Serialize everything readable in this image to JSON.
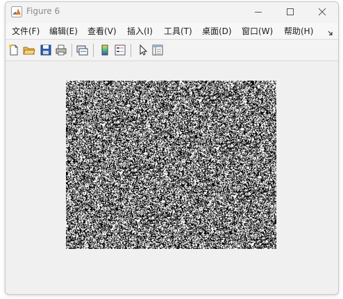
{
  "window": {
    "title": "Figure 6",
    "icons": {
      "app": "matlab-logo-icon",
      "minimize": "minimize-icon",
      "maximize": "maximize-icon",
      "close": "close-icon"
    }
  },
  "menu": {
    "items": [
      {
        "label": "文件(F)"
      },
      {
        "label": "编辑(E)"
      },
      {
        "label": "查看(V)"
      },
      {
        "label": "插入(I)"
      },
      {
        "label": "工具(T)"
      },
      {
        "label": "桌面(D)"
      },
      {
        "label": "窗口(W)"
      },
      {
        "label": "帮助(H)"
      }
    ],
    "overflow_icon": "chevron-overflow-icon"
  },
  "toolbar": {
    "buttons": [
      {
        "icon": "new-figure-icon"
      },
      {
        "icon": "open-file-icon"
      },
      {
        "icon": "save-icon"
      },
      {
        "icon": "print-icon"
      },
      {
        "icon": "link-plot-icon"
      },
      {
        "icon": "insert-colorbar-icon"
      },
      {
        "icon": "insert-legend-icon"
      },
      {
        "icon": "edit-plot-pointer-icon"
      },
      {
        "icon": "open-property-inspector-icon"
      }
    ]
  },
  "figure": {
    "content": "random-noise-image",
    "colors": {
      "dark": "#000000",
      "light": "#ffffff"
    }
  }
}
